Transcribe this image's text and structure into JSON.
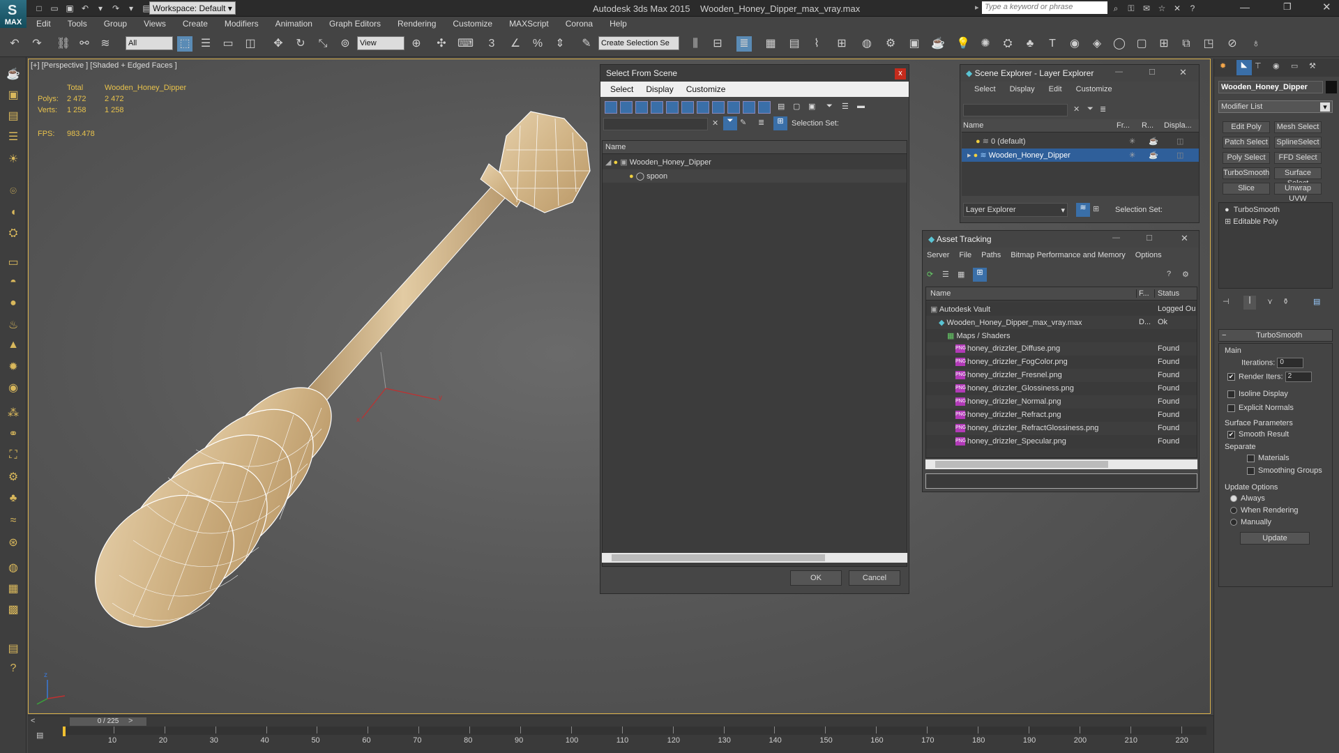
{
  "app": {
    "logo": "MAX",
    "workspace": "Workspace: Default",
    "product": "Autodesk 3ds Max  2015",
    "file": "Wooden_Honey_Dipper_max_vray.max",
    "search_placeholder": "Type a keyword or phrase"
  },
  "menu": [
    "Edit",
    "Tools",
    "Group",
    "Views",
    "Create",
    "Modifiers",
    "Animation",
    "Graph Editors",
    "Rendering",
    "Customize",
    "MAXScript",
    "Corona",
    "Help"
  ],
  "toolbar": {
    "selection_filter": "All",
    "ref_coord": "View",
    "named_selection_placeholder": "Create Selection Se",
    "snap_labels": [
      "3",
      "%"
    ]
  },
  "viewport": {
    "label": "[+] [Perspective ] [Shaded + Edged Faces ]",
    "stats": {
      "header_total": "Total",
      "header_object": "Wooden_Honey_Dipper",
      "polys_label": "Polys:",
      "polys_total": "2 472",
      "polys_obj": "2 472",
      "verts_label": "Verts:",
      "verts_total": "1 258",
      "verts_obj": "1 258",
      "fps_label": "FPS:",
      "fps_value": "983.478"
    },
    "gizmo_axis_y": "y",
    "gizmo_axis_x": "x",
    "corner_axis_z": "z"
  },
  "select_dialog": {
    "title": "Select From Scene",
    "close": "x",
    "menu": [
      "Select",
      "Display",
      "Customize"
    ],
    "selection_set_label": "Selection Set:",
    "column_name": "Name",
    "tree": [
      {
        "label": "Wooden_Honey_Dipper",
        "depth": 0
      },
      {
        "label": "spoon",
        "depth": 1
      }
    ],
    "ok": "OK",
    "cancel": "Cancel"
  },
  "scene_explorer": {
    "title": "Scene Explorer - Layer Explorer",
    "menu": [
      "Select",
      "Display",
      "Edit",
      "Customize"
    ],
    "columns": [
      "Name",
      "Fr...",
      "R...",
      "Displa..."
    ],
    "rows": [
      {
        "label": "0 (default)",
        "selected": false
      },
      {
        "label": "Wooden_Honey_Dipper",
        "selected": true
      }
    ],
    "footer_dropdown": "Layer Explorer",
    "selection_set_label": "Selection Set:"
  },
  "asset_tracking": {
    "title": "Asset Tracking",
    "menu": [
      "Server",
      "File",
      "Paths",
      "Bitmap Performance and Memory",
      "Options"
    ],
    "columns": [
      "Name",
      "F...",
      "Status"
    ],
    "rows": [
      {
        "name": "Autodesk Vault",
        "f": "",
        "status": "Logged Ou",
        "indent": 0,
        "type": "vault"
      },
      {
        "name": "Wooden_Honey_Dipper_max_vray.max",
        "f": "D...",
        "status": "Ok",
        "indent": 1,
        "type": "max"
      },
      {
        "name": "Maps / Shaders",
        "f": "",
        "status": "",
        "indent": 2,
        "type": "folder"
      },
      {
        "name": "honey_drizzler_Diffuse.png",
        "f": "",
        "status": "Found",
        "indent": 3,
        "type": "png"
      },
      {
        "name": "honey_drizzler_FogColor.png",
        "f": "",
        "status": "Found",
        "indent": 3,
        "type": "png"
      },
      {
        "name": "honey_drizzler_Fresnel.png",
        "f": "",
        "status": "Found",
        "indent": 3,
        "type": "png"
      },
      {
        "name": "honey_drizzler_Glossiness.png",
        "f": "",
        "status": "Found",
        "indent": 3,
        "type": "png"
      },
      {
        "name": "honey_drizzler_Normal.png",
        "f": "",
        "status": "Found",
        "indent": 3,
        "type": "png"
      },
      {
        "name": "honey_drizzler_Refract.png",
        "f": "",
        "status": "Found",
        "indent": 3,
        "type": "png"
      },
      {
        "name": "honey_drizzler_RefractGlossiness.png",
        "f": "",
        "status": "Found",
        "indent": 3,
        "type": "png"
      },
      {
        "name": "honey_drizzler_Specular.png",
        "f": "",
        "status": "Found",
        "indent": 3,
        "type": "png"
      }
    ],
    "png_badge": "PNG"
  },
  "command_panel": {
    "object_name": "Wooden_Honey_Dipper",
    "modifier_list": "Modifier List",
    "modifier_buttons": [
      "Edit Poly",
      "Mesh Select",
      "Patch Select",
      "SplineSelect",
      "Poly Select",
      "FFD Select",
      "TurboSmooth",
      "Surface Select",
      "Slice",
      "Unwrap UVW"
    ],
    "stack": [
      "TurboSmooth",
      "Editable Poly"
    ],
    "rollout_title": "TurboSmooth",
    "main_label": "Main",
    "iterations_label": "Iterations:",
    "iterations_value": "0",
    "render_iters_label": "Render Iters:",
    "render_iters_value": "2",
    "isoline_label": "Isoline Display",
    "explicit_normals_label": "Explicit Normals",
    "surface_params_label": "Surface Parameters",
    "smooth_result_label": "Smooth Result",
    "separate_label": "Separate",
    "materials_label": "Materials",
    "smoothing_groups_label": "Smoothing Groups",
    "update_options_label": "Update Options",
    "always_label": "Always",
    "when_rendering_label": "When Rendering",
    "manually_label": "Manually",
    "update_button": "Update"
  },
  "timeline": {
    "position": "0 / 225",
    "ticks": [
      "10",
      "20",
      "30",
      "40",
      "50",
      "60",
      "70",
      "80",
      "90",
      "100",
      "110",
      "120",
      "130",
      "140",
      "150",
      "160",
      "170",
      "180",
      "190",
      "200",
      "210",
      "220"
    ]
  }
}
